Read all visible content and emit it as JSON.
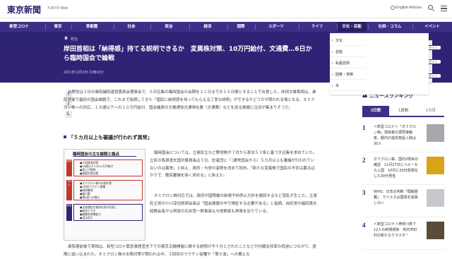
{
  "header": {
    "logo": "東京新聞",
    "logo_sub": "TOKYO Web",
    "lang": "English Articles"
  },
  "nav": {
    "items": [
      "新型コロナ",
      "東京",
      "首都圏",
      "社会",
      "政治",
      "経済",
      "国際",
      "スポーツ",
      "ライフ",
      "文化・芸能",
      "社説・コラム",
      "イベント"
    ],
    "active": "文化・芸能"
  },
  "dropdown": {
    "items": [
      "文化",
      "芸能",
      "私藝芸術",
      "囲碁・将棋",
      "本"
    ]
  },
  "article": {
    "breadcrumb": "政治",
    "title": "岸田首相は「納得感」持てる説明できるか　変異株対策、10万円給付、文通費…6日から臨時国会で論戦",
    "date": "2021年12月3日 21時33分",
    "p1": "与野党は３日の衆院議院運営委員会理事会で、６日召集の臨時国会の会期を２１日までの１６日間とすることで合意した。岸田文雄首相は、衆院選後で最初の国会論戦で、これまで強調してきた「国民に納得感を持ってもらえる丁寧な説明」ができるかどうかが問われる場となる。オミクロン株への対応、１８歳以下への１０万円給付、国会議員の文書通信交通滞在費（文通費）などを巡る論戦に注目が集まりそうだ。",
    "subhead": "「５カ月以上も審議が行われず異常」",
    "p2": "臨時国会については、立憲民主など野党側が７月から憲法５３条に基づき召集を求めていた。立民の馬淵澄夫国対委員長は３日、記者団に「（通常国会から）５カ月以上も審議が行われていないのは異常」と訴え、政府・与党の姿勢を改めて批判。「新たな変異株で国民の不安は募るばかりで、徹底審議を強く求める」と訴えた。",
    "p3": "オミクロン株対応では、政府が国際線の新規予約停止方針を撤回するなど混乱が生じた。立憲民主党の小川淳也政調会長は「国会論戦の中で検証する必要がある」と指摘。自民党の福田達夫総務会長や公明党の石井啓一幹事長も与党幹部も再発を足りている。",
    "p4": "衆院選前後で首相は、新型コロナ緊急事態宣言下での東京五輪開催に関する説明が不十分とされたことなどが内閣支持率の低迷につながり、退陣に追い込まれた。オミクロン株の水際対策が問われる中、３回目のワクチン接種や「第６波」への備えな"
  },
  "figure": {
    "title": "臨時国会の主な論戦と論点",
    "groups": [
      {
        "tag": "経済",
        "color": "#c0392b",
        "lines": [
          "●大型経済対策",
          "●18歳以下への10万円給付",
          "●賃上げ税制",
          "●困窮世帯支援"
        ]
      },
      {
        "tag": "コロナ",
        "color": "#c0392b",
        "lines": [
          "●オミクロン株の水際対策",
          "●3回目ワクチン接種",
          "●病床確保",
          "●経口薬",
          "●第6波への備え"
        ]
      },
      {
        "tag": "政治",
        "color": "#2e2375",
        "lines": [
          "●文書通信交通滞在費の見直し",
          "●政治とカネ",
          "●敵基地攻撃能力",
          "●憲法改正"
        ]
      }
    ],
    "caption": ""
  },
  "sidebar": {
    "ad_pills": [
      "ログイン",
      "ログイン",
      "ログイン"
    ],
    "ranking_title": "ニュースランキング",
    "tabs": [
      "3日間",
      "1週間",
      "1カ月"
    ],
    "active_tab": "3日間",
    "items": [
      {
        "rank": "1",
        "text": "＜新型コロナ＞「オミクロン株」感染者の濃厚接触者、都内の指定施設入院は30人"
      },
      {
        "rank": "2",
        "text": "オミクロン株、国内2例目の確認　11月27日にペルーから入国　10月に20日間滞在した30代男性"
      },
      {
        "rank": "3",
        "text": "WHO、日本の判断「理解困難」　ウイルスは国境を認識しない"
      },
      {
        "rank": "4",
        "text": "＜新型コロナ＞神奈川県で12人の新規感染　県内市町村の新たなクラスター"
      }
    ]
  },
  "colors": {
    "brand": "#3b2f86",
    "band": "#2e2375"
  }
}
